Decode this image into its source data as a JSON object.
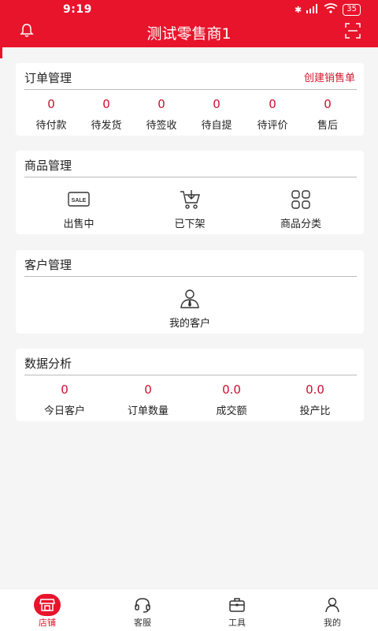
{
  "status_bar": {
    "time": "9:19",
    "battery": "35"
  },
  "header": {
    "title": "测试零售商1",
    "bell_icon": "bell-icon",
    "scan_icon": "scan-icon"
  },
  "orders": {
    "title": "订单管理",
    "link": "创建销售单",
    "stats": [
      {
        "value": "0",
        "label": "待付款"
      },
      {
        "value": "0",
        "label": "待发货"
      },
      {
        "value": "0",
        "label": "待签收"
      },
      {
        "value": "0",
        "label": "待自提"
      },
      {
        "value": "0",
        "label": "待评价"
      },
      {
        "value": "0",
        "label": "售后"
      }
    ]
  },
  "products": {
    "title": "商品管理",
    "items": [
      {
        "label": "出售中",
        "icon": "sale-tag-icon"
      },
      {
        "label": "已下架",
        "icon": "cart-down-icon"
      },
      {
        "label": "商品分类",
        "icon": "grid-icon"
      }
    ]
  },
  "customers": {
    "title": "客户管理",
    "items": [
      {
        "label": "我的客户",
        "icon": "user-tie-icon"
      }
    ]
  },
  "analytics": {
    "title": "数据分析",
    "stats": [
      {
        "value": "0",
        "label": "今日客户"
      },
      {
        "value": "0",
        "label": "订单数量"
      },
      {
        "value": "0.0",
        "label": "成交额"
      },
      {
        "value": "0.0",
        "label": "投产比"
      }
    ]
  },
  "tabbar": {
    "tabs": [
      {
        "label": "店铺",
        "icon": "store-icon",
        "active": true
      },
      {
        "label": "客服",
        "icon": "headset-icon",
        "active": false
      },
      {
        "label": "工具",
        "icon": "toolbox-icon",
        "active": false
      },
      {
        "label": "我的",
        "icon": "person-icon",
        "active": false
      }
    ]
  },
  "colors": {
    "brand": "#e8142b",
    "value_red": "#c8102e",
    "background": "#f5f5f5"
  }
}
